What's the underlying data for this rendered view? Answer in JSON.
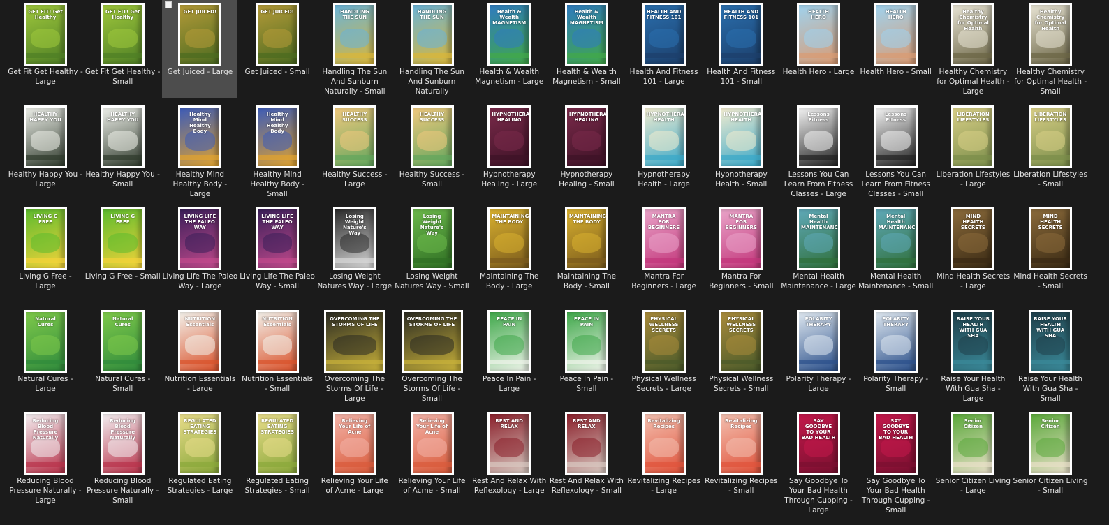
{
  "items": [
    {
      "label": "Get Fit Get Healthy - Large",
      "cover_title": "GET FIT! Get Healthy",
      "c1": "#9fc83c",
      "c2": "#4f7f25"
    },
    {
      "label": "Get Fit Get Healthy - Small",
      "cover_title": "GET FIT! Get Healthy",
      "c1": "#9fc83c",
      "c2": "#4f7f25"
    },
    {
      "label": "Get Juiced - Large",
      "cover_title": "GET JUICED!",
      "c1": "#b49a38",
      "c2": "#4c6b20",
      "selected": true
    },
    {
      "label": "Get Juiced - Small",
      "cover_title": "GET JUICED!",
      "c1": "#b49a38",
      "c2": "#4c6b20"
    },
    {
      "label": "Handling The Sun And Sunburn Naturally - Small",
      "cover_title": "HANDLING THE SUN",
      "c1": "#6ab3d8",
      "c2": "#d8b63a"
    },
    {
      "label": "Handling The Sun And Sunburn Naturally",
      "cover_title": "HANDLING THE SUN",
      "c1": "#6ab3d8",
      "c2": "#d8b63a"
    },
    {
      "label": "Health & Wealth Magnetism - Large",
      "cover_title": "Health & Wealth MAGNETISM",
      "c1": "#2f7bbf",
      "c2": "#41a84a"
    },
    {
      "label": "Health & Wealth Magnetism - Small",
      "cover_title": "Health & Wealth MAGNETISM",
      "c1": "#2f7bbf",
      "c2": "#41a84a"
    },
    {
      "label": "Health And Fitness 101 - Large",
      "cover_title": "HEALTH AND FITNESS 101",
      "c1": "#2a6fae",
      "c2": "#1c3f6b"
    },
    {
      "label": "Health And Fitness 101 - Small",
      "cover_title": "HEALTH AND FITNESS 101",
      "c1": "#2a6fae",
      "c2": "#1c3f6b"
    },
    {
      "label": "Health Hero - Large",
      "cover_title": "HEALTH HERO",
      "c1": "#9fd2ee",
      "c2": "#d99b73"
    },
    {
      "label": "Health Hero - Small",
      "cover_title": "HEALTH HERO",
      "c1": "#9fd2ee",
      "c2": "#d99b73"
    },
    {
      "label": "Healthy Chemistry for Optimal Health - Large",
      "cover_title": "Healthy Chemistry for Optimal Health",
      "c1": "#e8e4d4",
      "c2": "#6b6545"
    },
    {
      "label": "Healthy Chemistry for Optimal Health - Small",
      "cover_title": "Healthy Chemistry for Optimal Health",
      "c1": "#e8e4d4",
      "c2": "#6b6545"
    },
    {
      "label": "Healthy Happy You - Large",
      "cover_title": "HEALTHY HAPPY YOU",
      "c1": "#eef0ea",
      "c2": "#2f3a2c"
    },
    {
      "label": "Healthy Happy You - Small",
      "cover_title": "HEALTHY HAPPY YOU",
      "c1": "#eef0ea",
      "c2": "#2f3a2c"
    },
    {
      "label": "Healthy Mind Healthy Body - Large",
      "cover_title": "Healthy Mind Healthy Body",
      "c1": "#3c5bb8",
      "c2": "#e0a330"
    },
    {
      "label": "Healthy Mind Healthy Body - Small",
      "cover_title": "Healthy Mind Healthy Body",
      "c1": "#3c5bb8",
      "c2": "#e0a330"
    },
    {
      "label": "Healthy Success - Large",
      "cover_title": "HEALTHY SUCCESS",
      "c1": "#f1c97e",
      "c2": "#62a55c"
    },
    {
      "label": "Healthy Success - Small",
      "cover_title": "HEALTHY SUCCESS",
      "c1": "#f1c97e",
      "c2": "#62a55c"
    },
    {
      "label": "Hypnotherapy Healing - Large",
      "cover_title": "HYPNOTHERAPY HEALING",
      "c1": "#7a2a4a",
      "c2": "#3d1226"
    },
    {
      "label": "Hypnotherapy Healing - Small",
      "cover_title": "HYPNOTHERAPY HEALING",
      "c1": "#7a2a4a",
      "c2": "#3d1226"
    },
    {
      "label": "Hypnotherapy Health - Large",
      "cover_title": "HYPNOTHERAPY HEALTH",
      "c1": "#f3ecd0",
      "c2": "#3aa8c8"
    },
    {
      "label": "Hypnotherapy Health - Small",
      "cover_title": "HYPNOTHERAPY HEALTH",
      "c1": "#f3ecd0",
      "c2": "#3aa8c8"
    },
    {
      "label": "Lessons You Can Learn From Fitness Classes - Large",
      "cover_title": "Lessons Fitness",
      "c1": "#f4f4f4",
      "c2": "#222222"
    },
    {
      "label": "Lessons You Can Learn From Fitness Classes - Small",
      "cover_title": "Lessons Fitness",
      "c1": "#f4f4f4",
      "c2": "#222222"
    },
    {
      "label": "Liberation Lifestyles - Large",
      "cover_title": "LIBERATION LIFESTYLES",
      "c1": "#d9cf86",
      "c2": "#7a8d4a"
    },
    {
      "label": "Liberation Lifestyles - Small",
      "cover_title": "LIBERATION LIFESTYLES",
      "c1": "#d9cf86",
      "c2": "#7a8d4a"
    },
    {
      "label": "Living G Free - Large",
      "cover_title": "LIVING G FREE",
      "c1": "#5dbb2e",
      "c2": "#f4d33a"
    },
    {
      "label": "Living G Free - Small",
      "cover_title": "LIVING G FREE",
      "c1": "#5dbb2e",
      "c2": "#f4d33a"
    },
    {
      "label": "Living Life The Paleo Way - Large",
      "cover_title": "LIVING LIFE THE PALEO WAY",
      "c1": "#3b1f5a",
      "c2": "#c24a8c"
    },
    {
      "label": "Living Life The Paleo Way - Small",
      "cover_title": "LIVING LIFE THE PALEO WAY",
      "c1": "#3b1f5a",
      "c2": "#c24a8c"
    },
    {
      "label": "Losing Weight Natures Way - Large",
      "cover_title": "Losing Weight Nature's Way",
      "c1": "#2c2c2c",
      "c2": "#d8d8d8"
    },
    {
      "label": "Losing Weight Natures Way - Small",
      "cover_title": "Losing Weight Nature's Way",
      "c1": "#6bb84a",
      "c2": "#2f6f24"
    },
    {
      "label": "Maintaining The Body - Large",
      "cover_title": "MAINTAINING THE BODY",
      "c1": "#d9b12f",
      "c2": "#7a5a1c"
    },
    {
      "label": "Maintaining The Body - Small",
      "cover_title": "MAINTAINING THE BODY",
      "c1": "#d9b12f",
      "c2": "#7a5a1c"
    },
    {
      "label": "Mantra For Beginners - Large",
      "cover_title": "MANTRA FOR BEGINNERS",
      "c1": "#e9a3c8",
      "c2": "#c2357a"
    },
    {
      "label": "Mantra For Beginners - Small",
      "cover_title": "MANTRA FOR BEGINNERS",
      "c1": "#e9a3c8",
      "c2": "#c2357a"
    },
    {
      "label": "Mental Health Maintenance - Large",
      "cover_title": "Mental Health MAINTENANCE",
      "c1": "#5fa9b8",
      "c2": "#2f6f3a"
    },
    {
      "label": "Mental Health Maintenance - Small",
      "cover_title": "Mental Health MAINTENANCE",
      "c1": "#5fa9b8",
      "c2": "#2f6f3a"
    },
    {
      "label": "Mind Health Secrets - Large",
      "cover_title": "MIND HEALTH SECRETS",
      "c1": "#8a6a3a",
      "c2": "#3a2a14"
    },
    {
      "label": "Mind Health Secrets - Small",
      "cover_title": "MIND HEALTH SECRETS",
      "c1": "#8a6a3a",
      "c2": "#3a2a14"
    },
    {
      "label": "Natural Cures - Large",
      "cover_title": "Natural Cures",
      "c1": "#7ec94a",
      "c2": "#2f8a3c"
    },
    {
      "label": "Natural Cures - Small",
      "cover_title": "Natural Cures",
      "c1": "#7ec94a",
      "c2": "#2f8a3c"
    },
    {
      "label": "Nutrition Essentials - Large",
      "cover_title": "NUTRITION Essentials",
      "c1": "#f3f1ea",
      "c2": "#d9512a"
    },
    {
      "label": "Nutrition Essentials - Small",
      "cover_title": "NUTRITION Essentials",
      "c1": "#f3f1ea",
      "c2": "#d9512a"
    },
    {
      "label": "Overcoming The Storms Of Life - Large",
      "cover_title": "OVERCOMING THE STORMS OF LIFE",
      "c1": "#2a2a22",
      "c2": "#c9b23a",
      "wide": true
    },
    {
      "label": "Overcoming The Storms Of Life - Small",
      "cover_title": "OVERCOMING THE STORMS OF LIFE",
      "c1": "#2a2a22",
      "c2": "#c9b23a",
      "wide": true
    },
    {
      "label": "Peace In Pain - Large",
      "cover_title": "PEACE IN PAIN",
      "c1": "#3fa84a",
      "c2": "#eef4ea"
    },
    {
      "label": "Peace In Pain - Small",
      "cover_title": "PEACE IN PAIN",
      "c1": "#3fa84a",
      "c2": "#eef4ea"
    },
    {
      "label": "Physical Wellness Secrets - Large",
      "cover_title": "PHYSICAL WELLNESS SECRETS",
      "c1": "#a88a3a",
      "c2": "#4a5a2a"
    },
    {
      "label": "Physical Wellness Secrets - Small",
      "cover_title": "PHYSICAL WELLNESS SECRETS",
      "c1": "#a88a3a",
      "c2": "#4a5a2a"
    },
    {
      "label": "Polarity Therapy - Large",
      "cover_title": "POLARITY THERAPY",
      "c1": "#dfe8f0",
      "c2": "#2a4f8a"
    },
    {
      "label": "Polarity Therapy - Small",
      "cover_title": "POLARITY THERAPY",
      "c1": "#dfe8f0",
      "c2": "#2a4f8a"
    },
    {
      "label": "Raise Your Health With Gua Sha - Large",
      "cover_title": "RAISE YOUR HEALTH WITH GUA SHA",
      "c1": "#1f3f4a",
      "c2": "#3a8a9a"
    },
    {
      "label": "Raise Your Health With Gua Sha - Small",
      "cover_title": "RAISE YOUR HEALTH WITH GUA SHA",
      "c1": "#1f3f4a",
      "c2": "#3a8a9a"
    },
    {
      "label": "Reducing Blood Pressure Naturally - Large",
      "cover_title": "Reducing Blood Pressure Naturally",
      "c1": "#f3eef0",
      "c2": "#b8324a"
    },
    {
      "label": "Reducing Blood Pressure Naturally - Small",
      "cover_title": "Reducing Blood Pressure Naturally",
      "c1": "#f3eef0",
      "c2": "#b8324a"
    },
    {
      "label": "Regulated Eating Strategies - Large",
      "cover_title": "REGULATED EATING STRATEGIES",
      "c1": "#e8dc8a",
      "c2": "#8aa83a"
    },
    {
      "label": "Regulated Eating Strategies - Small",
      "cover_title": "REGULATED EATING STRATEGIES",
      "c1": "#e8dc8a",
      "c2": "#8aa83a"
    },
    {
      "label": "Relieving Your Life of Acme - Large",
      "cover_title": "Relieving Your Life of Acne",
      "c1": "#f3b3a8",
      "c2": "#d95a3a"
    },
    {
      "label": "Relieving Your Life of Acme - Small",
      "cover_title": "Relieving Your Life of Acne",
      "c1": "#f3b3a8",
      "c2": "#d95a3a"
    },
    {
      "label": "Rest And Relax With Reflexology - Large",
      "cover_title": "REST AND RELAX",
      "c1": "#8a1f2a",
      "c2": "#d8c8c0"
    },
    {
      "label": "Rest And Relax With Reflexology - Small",
      "cover_title": "REST AND RELAX",
      "c1": "#8a1f2a",
      "c2": "#d8c8c0"
    },
    {
      "label": "Revitalizing Recipes - Large",
      "cover_title": "Revitalizing Recipes",
      "c1": "#f3c0b0",
      "c2": "#e0523a"
    },
    {
      "label": "Revitalizing Recipes - Small",
      "cover_title": "Revitalizing Recipes",
      "c1": "#f3c0b0",
      "c2": "#e0523a"
    },
    {
      "label": "Say Goodbye To Your Bad Health Through Cupping - Large",
      "cover_title": "SAY GOODBYE TO YOUR BAD HEALTH",
      "c1": "#c2184a",
      "c2": "#7a1030"
    },
    {
      "label": "Say Goodbye To Your Bad Health Through Cupping - Small",
      "cover_title": "SAY GOODBYE TO YOUR BAD HEALTH",
      "c1": "#c2184a",
      "c2": "#7a1030"
    },
    {
      "label": "Senior Citizen Living - Large",
      "cover_title": "Senior Citizen",
      "c1": "#5aa83a",
      "c2": "#e8e0c8"
    },
    {
      "label": "Senior Citizen Living - Small",
      "cover_title": "Senior Citizen",
      "c1": "#5aa83a",
      "c2": "#e8e0c8"
    }
  ]
}
